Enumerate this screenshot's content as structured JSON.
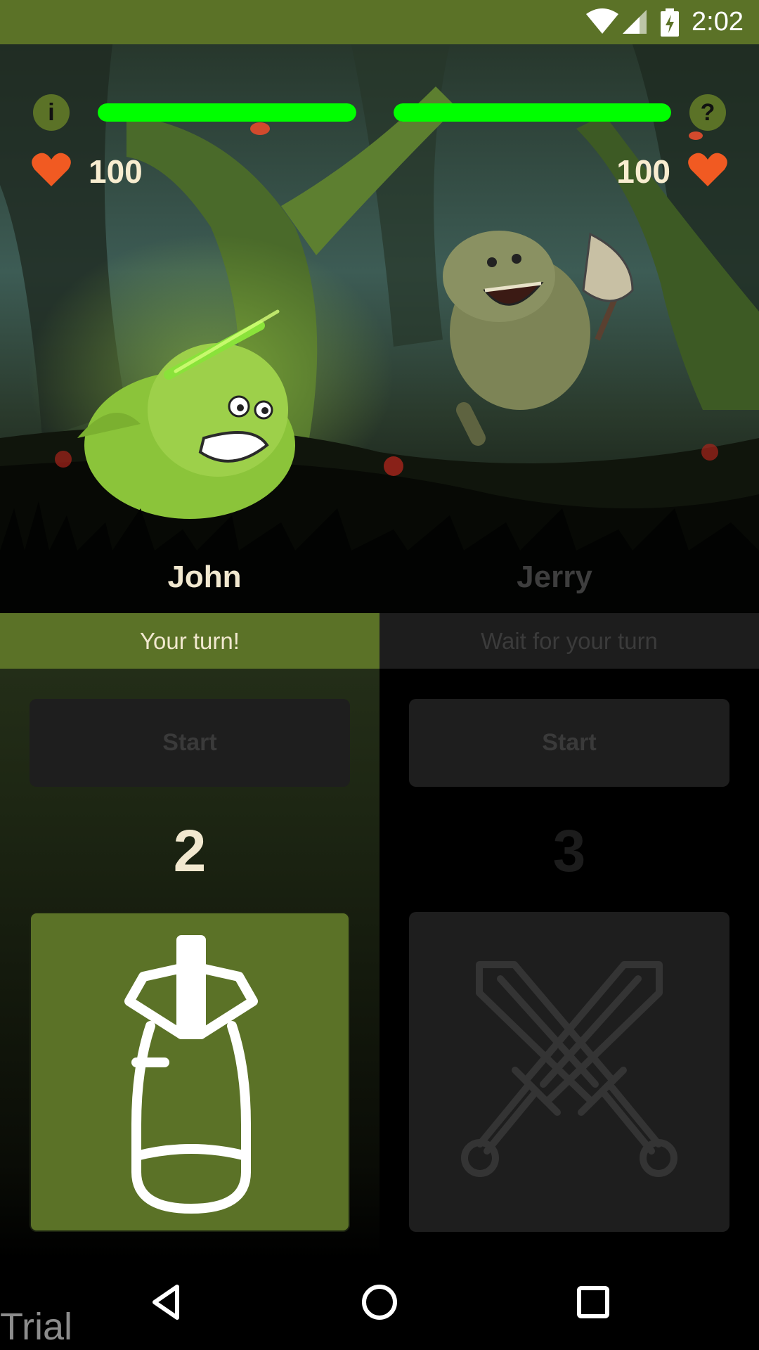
{
  "status_bar": {
    "time": "2:02",
    "icons": [
      "wifi-icon",
      "cell-signal-icon",
      "battery-charging-icon"
    ]
  },
  "hud": {
    "info_label": "i",
    "help_label": "?",
    "player1": {
      "name": "John",
      "hp": "100",
      "hp_fraction": 1.0
    },
    "player2": {
      "name": "Jerry",
      "hp": "100",
      "hp_fraction": 1.0
    }
  },
  "panels": {
    "left": {
      "turn_text": "Your turn!",
      "start_label": "Start",
      "count": "2",
      "action_icon": "bomb-icon"
    },
    "right": {
      "turn_text": "Wait for your turn",
      "start_label": "Start",
      "count": "3",
      "action_icon": "crossed-swords-icon"
    }
  },
  "nav": {
    "watermark": "Trial",
    "buttons": [
      "back-icon",
      "home-icon",
      "recents-icon"
    ]
  },
  "colors": {
    "accent": "#5b7227",
    "hp_bar": "#00ff00",
    "heart": "#f15a22",
    "active_text": "#f1e8cf"
  }
}
